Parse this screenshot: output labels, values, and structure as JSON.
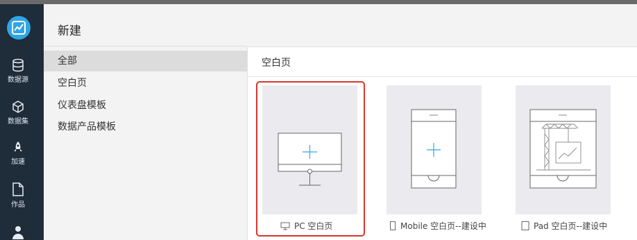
{
  "rail": {
    "items": [
      {
        "label": "数据源",
        "icon": "database-icon"
      },
      {
        "label": "数据集",
        "icon": "cube-icon"
      },
      {
        "label": "加速",
        "icon": "rocket-icon"
      },
      {
        "label": "作品",
        "icon": "document-icon"
      },
      {
        "label": "",
        "icon": "user-icon"
      }
    ]
  },
  "nav": {
    "title": "新建",
    "items": [
      {
        "label": "全部",
        "active": true
      },
      {
        "label": "空白页"
      },
      {
        "label": "仪表盘模板"
      },
      {
        "label": "数据产品模板"
      }
    ]
  },
  "main": {
    "section_title": "空白页",
    "cards": [
      {
        "caption": "PC 空白页",
        "icon": "monitor-icon",
        "selected": true
      },
      {
        "caption": "Mobile 空白页--建设中",
        "icon": "phone-icon"
      },
      {
        "caption": "Pad 空白页--建设中",
        "icon": "tablet-icon"
      }
    ]
  },
  "colors": {
    "rail_bg": "#1f2c3a",
    "accent": "#2fa6e6",
    "highlight": "#d9352b"
  }
}
